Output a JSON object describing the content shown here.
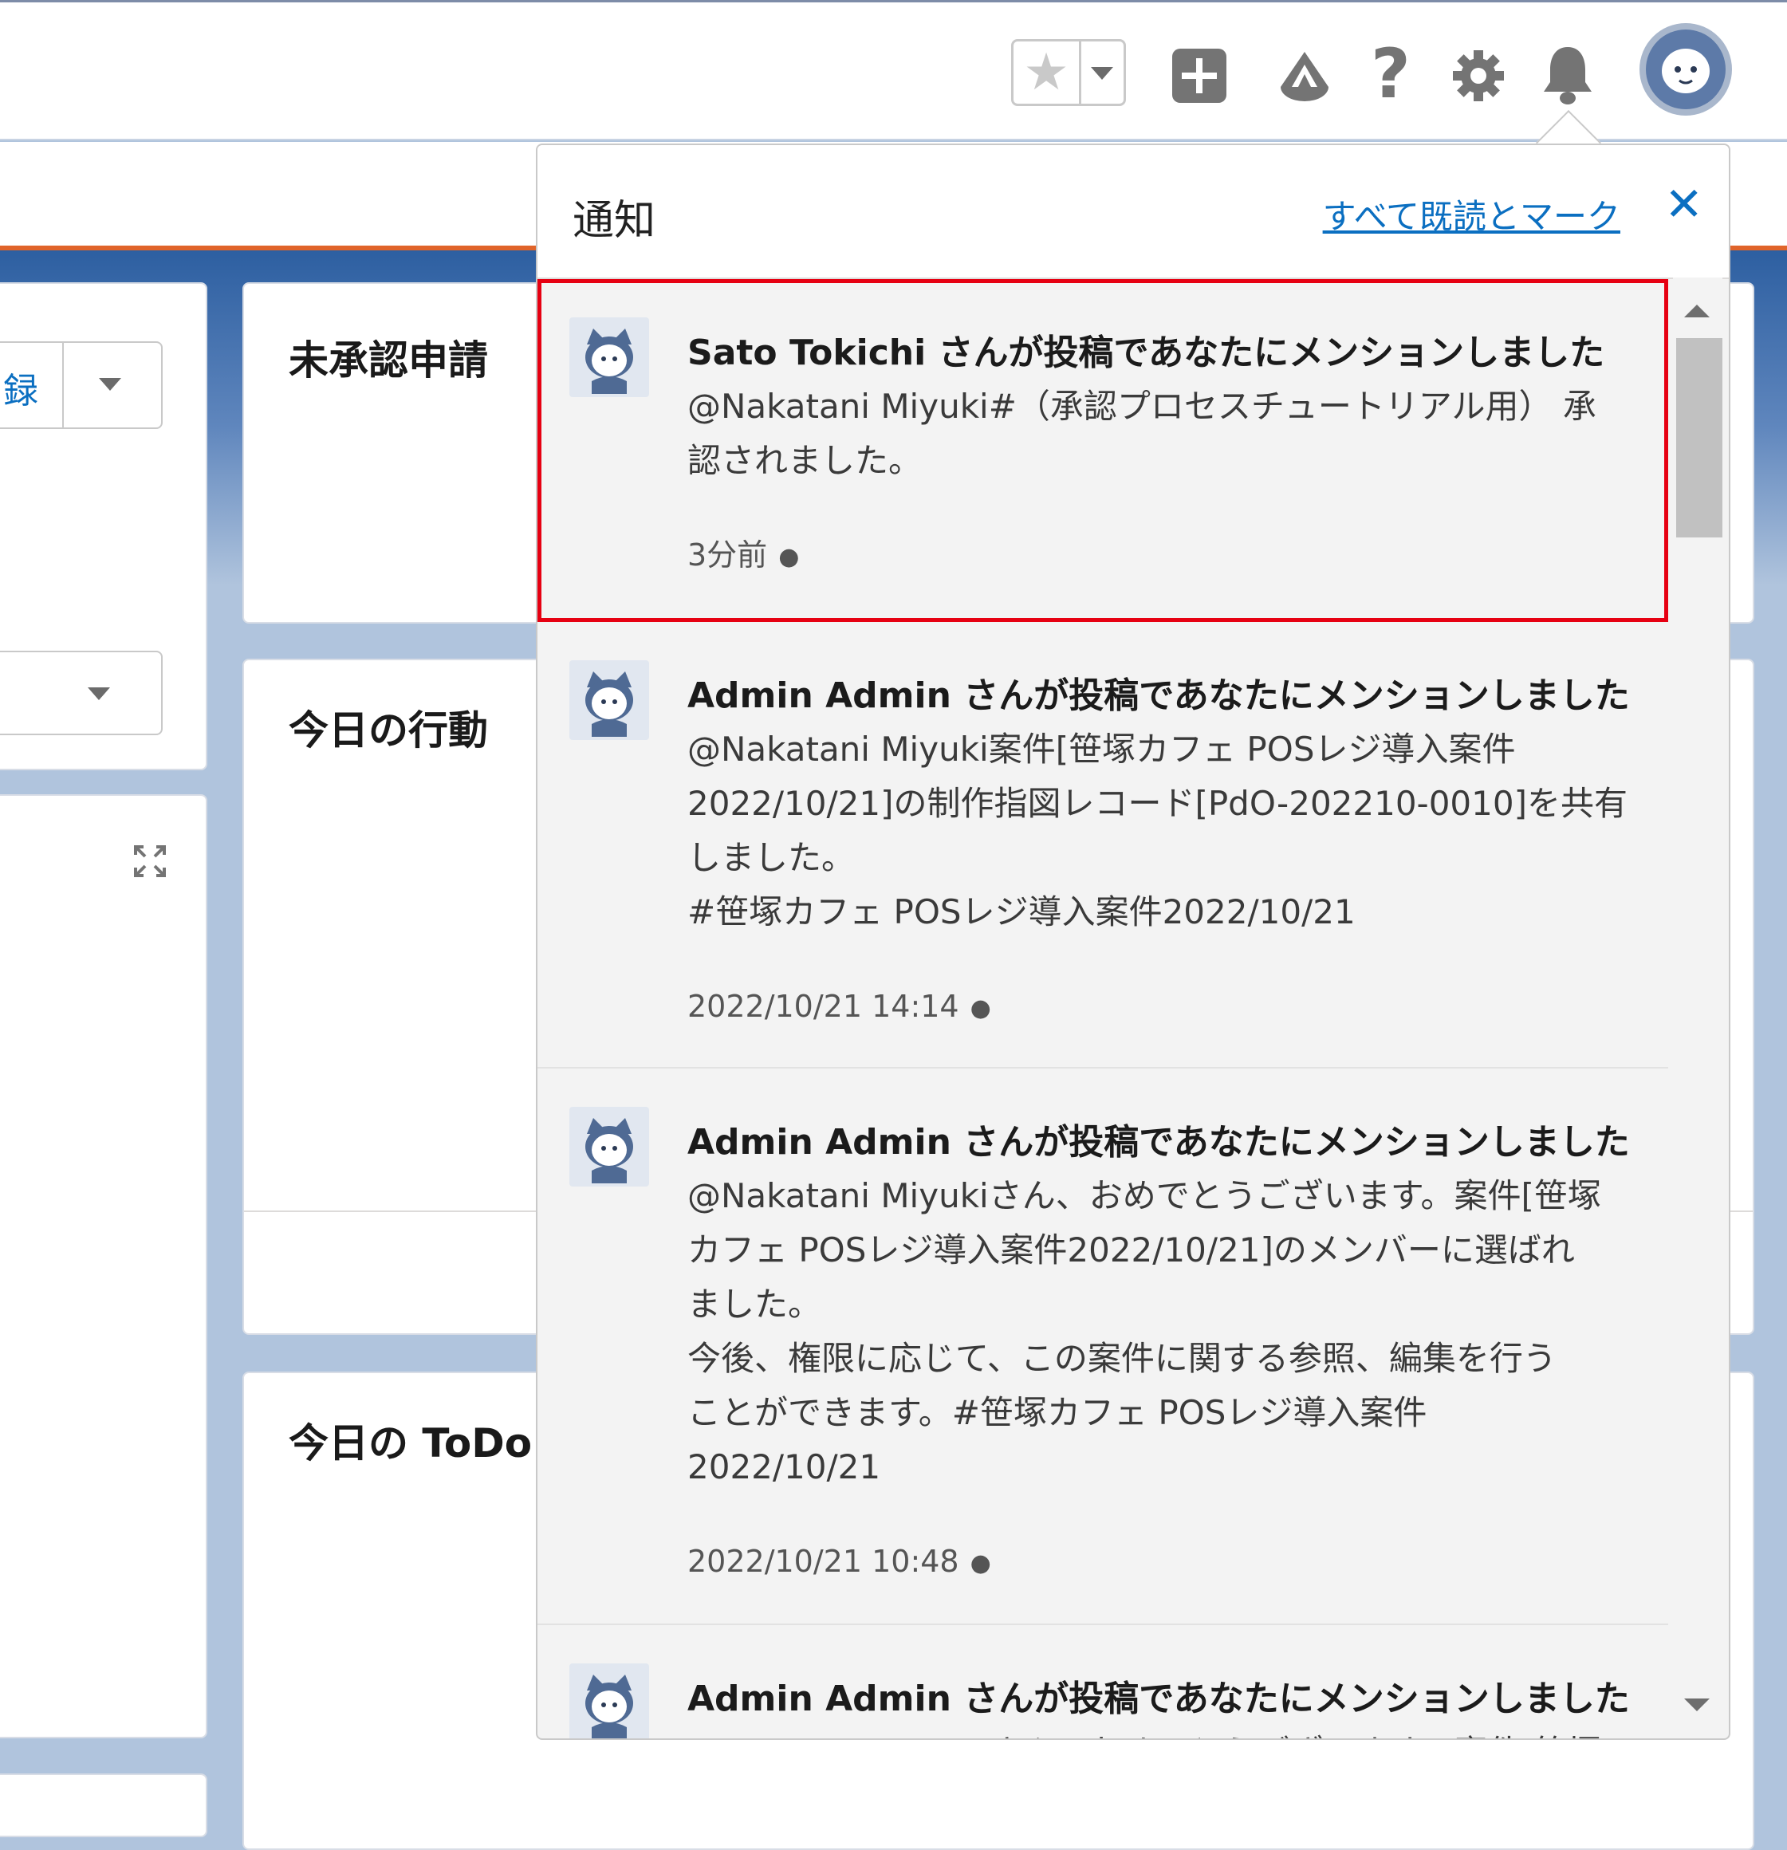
{
  "header": {
    "favorites_star": "★",
    "add_icon": "plus-square-icon",
    "trailhead_icon": "trailhead-icon",
    "help_label": "?",
    "settings_icon": "gear-icon",
    "notifications_icon": "bell-icon",
    "avatar_icon": "user-avatar-icon"
  },
  "background": {
    "left_link_fragment": "録",
    "cards": [
      {
        "title": "未承認申請"
      },
      {
        "title": "今日の行動"
      },
      {
        "title": "今日の ToDo"
      }
    ]
  },
  "notifications": {
    "title": "通知",
    "mark_all_read": "すべて既読とマーク",
    "close_label": "✕",
    "items": [
      {
        "title": "Sato Tokichi さんが投稿であなたにメンションしました",
        "body": "@Nakatani Miyuki#（承認プロセスチュートリアル用） 承\n認されました。",
        "time": "3分前",
        "unread": "●"
      },
      {
        "title": "Admin Admin さんが投稿であなたにメンションしました",
        "body": "@Nakatani Miyuki案件[笹塚カフェ POSレジ導入案件\n2022/10/21]の制作指図レコード[PdO-202210-0010]を共有\nしました。\n#笹塚カフェ POSレジ導入案件2022/10/21",
        "time": "2022/10/21 14:14",
        "unread": "●"
      },
      {
        "title": "Admin Admin さんが投稿であなたにメンションしました",
        "body": "@Nakatani Miyukiさん、おめでとうございます。案件[笹塚\nカフェ POSレジ導入案件2022/10/21]のメンバーに選ばれ\nました。\n今後、権限に応じて、この案件に関する参照、編集を行う\nことができます。#笹塚カフェ POSレジ導入案件\n2022/10/21",
        "time": "2022/10/21 10:48",
        "unread": "●"
      },
      {
        "title": "Admin Admin さんが投稿であなたにメンションしました",
        "body": "@Nakatani Miyukiさん、おめでとうございます。案件[笹塚",
        "time": "",
        "unread": ""
      }
    ]
  },
  "colors": {
    "accent": "#0b6fc1",
    "highlight": "#e60012",
    "brand_bar": "#e0642a"
  }
}
